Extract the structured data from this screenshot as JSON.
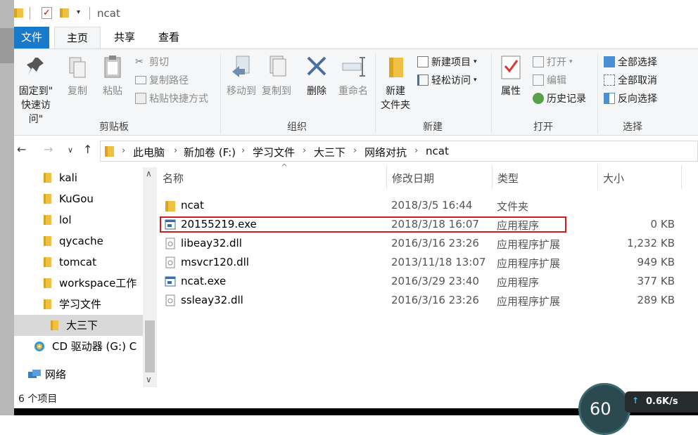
{
  "window": {
    "title": "ncat"
  },
  "tabs": [
    {
      "label": "文件"
    },
    {
      "label": "主页"
    },
    {
      "label": "共享"
    },
    {
      "label": "查看"
    }
  ],
  "ribbon": {
    "clipboard": {
      "label": "剪贴板",
      "pin_line1": "固定到\"",
      "pin_line2": "快速访问\"",
      "copy": "复制",
      "paste": "粘贴",
      "cut": "剪切",
      "copy_path": "复制路径",
      "paste_shortcut": "粘贴快捷方式"
    },
    "organize": {
      "label": "组织",
      "move_to": "移动到",
      "copy_to": "复制到",
      "delete": "删除",
      "rename": "重命名"
    },
    "new": {
      "label": "新建",
      "new_folder_line1": "新建",
      "new_folder_line2": "文件夹",
      "new_item": "新建项目",
      "easy_access": "轻松访问"
    },
    "open": {
      "label": "打开",
      "properties": "属性",
      "open": "打开",
      "edit": "编辑",
      "history": "历史记录"
    },
    "select": {
      "label": "选择",
      "select_all": "全部选择",
      "select_none": "全部取消",
      "invert": "反向选择"
    }
  },
  "address": {
    "crumbs": [
      "此电脑",
      "新加卷 (F:)",
      "学习文件",
      "大三下",
      "网络对抗",
      "ncat"
    ]
  },
  "nav_items": [
    {
      "label": "kali"
    },
    {
      "label": "KuGou"
    },
    {
      "label": "lol"
    },
    {
      "label": "qycache"
    },
    {
      "label": "tomcat"
    },
    {
      "label": "workspace工作"
    },
    {
      "label": "学习文件"
    },
    {
      "label": "大三下"
    },
    {
      "label": "CD 驱动器 (G:) C"
    },
    {
      "label": "网络"
    }
  ],
  "columns": {
    "name": "名称",
    "date": "修改日期",
    "type": "类型",
    "size": "大小"
  },
  "files": [
    {
      "name": "ncat",
      "date": "2018/3/5 16:44",
      "type": "文件夹",
      "size": "",
      "icon": "folder-icon"
    },
    {
      "name": "20155219.exe",
      "date": "2018/3/18 16:07",
      "type": "应用程序",
      "size": "0 KB",
      "icon": "exe-icon"
    },
    {
      "name": "libeay32.dll",
      "date": "2016/3/16 23:26",
      "type": "应用程序扩展",
      "size": "1,232 KB",
      "icon": "dll-icon"
    },
    {
      "name": "msvcr120.dll",
      "date": "2013/11/18 13:07",
      "type": "应用程序扩展",
      "size": "949 KB",
      "icon": "dll-icon"
    },
    {
      "name": "ncat.exe",
      "date": "2016/3/29 23:40",
      "type": "应用程序",
      "size": "377 KB",
      "icon": "exe-icon"
    },
    {
      "name": "ssleay32.dll",
      "date": "2016/3/16 23:26",
      "type": "应用程序扩展",
      "size": "289 KB",
      "icon": "dll-icon"
    }
  ],
  "status": {
    "item_count": "6 个项目"
  },
  "overlay": {
    "gauge": "60",
    "net_speed": "0.6K/s"
  },
  "colors": {
    "accent": "#1979ca",
    "highlight_border": "#d11a1a",
    "folder": "#f0c043"
  }
}
